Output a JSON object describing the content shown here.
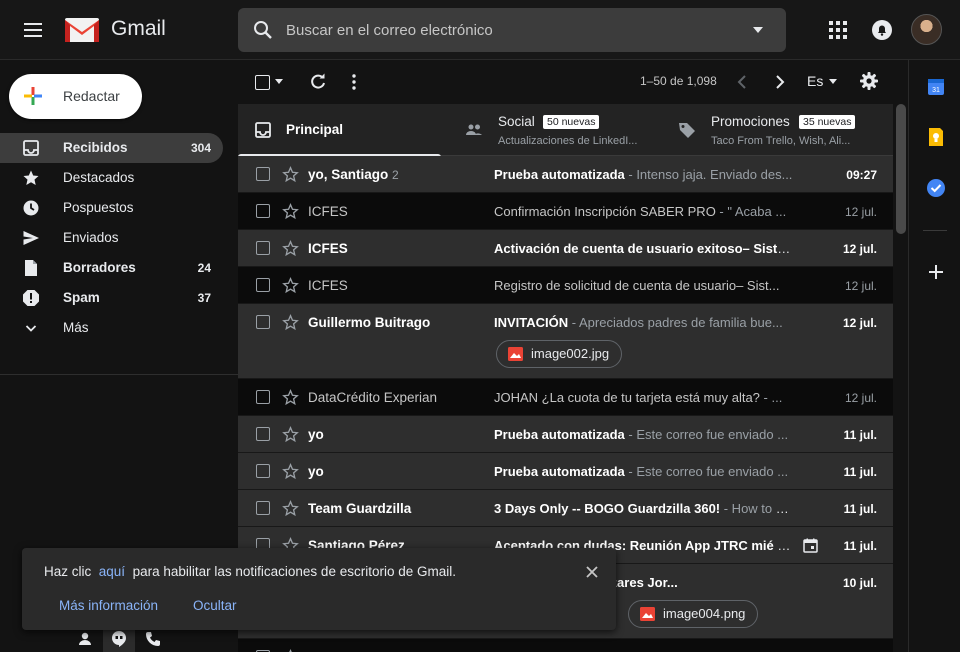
{
  "header": {
    "app_name": "Gmail",
    "search_placeholder": "Buscar en el correo electrónico"
  },
  "sidebar": {
    "compose_label": "Redactar",
    "items": [
      {
        "label": "Recibidos",
        "count": "304",
        "icon": "inbox-icon",
        "active": true,
        "bold": true
      },
      {
        "label": "Destacados",
        "count": "",
        "icon": "star-icon",
        "active": false,
        "bold": false
      },
      {
        "label": "Pospuestos",
        "count": "",
        "icon": "clock-icon",
        "active": false,
        "bold": false
      },
      {
        "label": "Enviados",
        "count": "",
        "icon": "send-icon",
        "active": false,
        "bold": false
      },
      {
        "label": "Borradores",
        "count": "24",
        "icon": "draft-icon",
        "active": false,
        "bold": true
      },
      {
        "label": "Spam",
        "count": "37",
        "icon": "spam-icon",
        "active": false,
        "bold": true
      },
      {
        "label": "Más",
        "count": "",
        "icon": "chevron-down-icon",
        "active": false,
        "bold": false
      }
    ]
  },
  "toolbar": {
    "range": "1–50 de 1,098",
    "language": "Es"
  },
  "tabs": [
    {
      "title": "Principal",
      "subtitle": "",
      "badge": "",
      "icon": "inbox-icon"
    },
    {
      "title": "Social",
      "subtitle": "Actualizaciones de LinkedI...",
      "badge": "50 nuevas",
      "icon": "people-icon"
    },
    {
      "title": "Promociones",
      "subtitle": "Taco From Trello, Wish, Ali...",
      "badge": "35 nuevas",
      "icon": "tag-icon"
    }
  ],
  "emails": [
    {
      "sender": "yo, Santiago",
      "count": "2",
      "subject": "Prueba automatizada",
      "snippet": " - Intenso jaja. Enviado des...",
      "date": "09:27",
      "unread": true,
      "attachments": []
    },
    {
      "sender": "ICFES",
      "count": "",
      "subject": "Confirmación Inscripción SABER PRO",
      "snippet": " - \" Acaba ...",
      "date": "12 jul.",
      "unread": false,
      "attachments": []
    },
    {
      "sender": "ICFES",
      "count": "",
      "subject": "Activación de cuenta de usuario exitoso– Siste...",
      "snippet": "",
      "date": "12 jul.",
      "unread": true,
      "attachments": []
    },
    {
      "sender": "ICFES",
      "count": "",
      "subject": "Registro de solicitud de cuenta de usuario– Sist...",
      "snippet": "",
      "date": "12 jul.",
      "unread": false,
      "attachments": []
    },
    {
      "sender": "Guillermo Buitrago",
      "count": "",
      "subject": "INVITACIÓN",
      "snippet": " - Apreciados padres de familia bue...",
      "date": "12 jul.",
      "unread": true,
      "attachments": [
        "image002.jpg"
      ]
    },
    {
      "sender": "DataCrédito Experian",
      "count": "",
      "subject": "JOHAN ¿La cuota de tu tarjeta está muy alta?",
      "snippet": " - ...",
      "date": "12 jul.",
      "unread": false,
      "attachments": []
    },
    {
      "sender": "yo",
      "count": "",
      "subject": "Prueba automatizada",
      "snippet": " - Este correo fue enviado ...",
      "date": "11 jul.",
      "unread": true,
      "attachments": []
    },
    {
      "sender": "yo",
      "count": "",
      "subject": "Prueba automatizada",
      "snippet": " - Este correo fue enviado ...",
      "date": "11 jul.",
      "unread": true,
      "attachments": []
    },
    {
      "sender": "Team Guardzilla",
      "count": "",
      "subject": "3 Days Only -- BOGO Guardzilla 360!",
      "snippet": " - How to G...",
      "date": "11 jul.",
      "unread": true,
      "attachments": []
    },
    {
      "sender": "Santiago Pérez",
      "count": "",
      "subject": "Aceptado con dudas: Reunión App JTRC mié 11...",
      "snippet": "",
      "date": "11 jul.",
      "unread": true,
      "attachments": [],
      "calendar": true
    },
    {
      "sender": "",
      "count": "",
      "subject": "Gimnasio Los Alcázares Jor...",
      "snippet": "",
      "date": "10 jul.",
      "unread": true,
      "attachments": [
        "image004.png"
      ]
    }
  ],
  "notification": {
    "text_before": "Haz clic",
    "link": "aquí",
    "text_after": "para habilitar las notificaciones de escritorio de Gmail.",
    "more_info": "Más información",
    "hide": "Ocultar"
  },
  "colors": {
    "background": "#131313",
    "unread_row": "#2e2e2e",
    "read_row": "#0b0b0b",
    "link": "#8ab4f8",
    "gmail_red": "#ea4335"
  }
}
